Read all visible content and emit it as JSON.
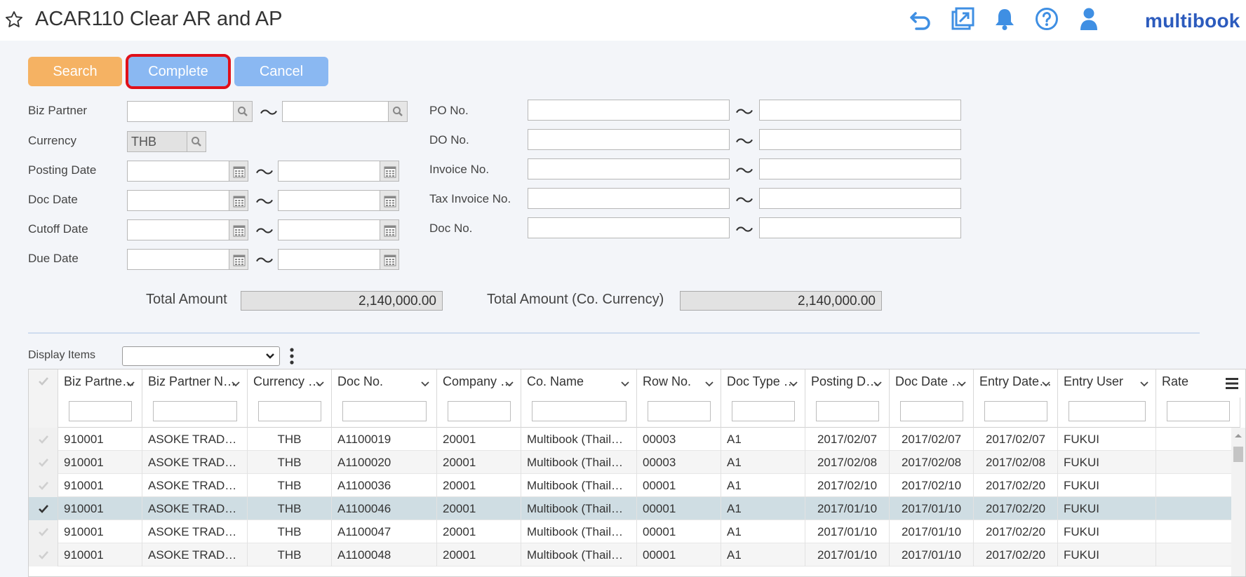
{
  "header": {
    "title": "ACAR110 Clear AR and AP",
    "brand": "multibook",
    "icons": [
      "star-icon",
      "undo-icon",
      "external-window-icon",
      "bell-icon",
      "help-icon",
      "user-icon"
    ],
    "accent": "#3f8fe3"
  },
  "toolbar": {
    "search_label": "Search",
    "complete_label": "Complete",
    "cancel_label": "Cancel"
  },
  "form": {
    "biz_partner_label": "Biz Partner",
    "currency_label": "Currency",
    "currency_value": "THB",
    "posting_date_label": "Posting Date",
    "doc_date_label": "Doc Date",
    "cutoff_date_label": "Cutoff Date",
    "due_date_label": "Due Date",
    "po_no_label": "PO No.",
    "do_no_label": "DO No.",
    "invoice_no_label": "Invoice No.",
    "tax_invoice_no_label": "Tax Invoice No.",
    "doc_no_label": "Doc No.",
    "range_separator": "〜",
    "total_amount_label": "Total Amount",
    "total_amount_value": "2,140,000.00",
    "total_amount_co_label": "Total Amount (Co. Currency)",
    "total_amount_co_value": "2,140,000.00"
  },
  "grid": {
    "display_items_label": "Display Items",
    "columns": [
      "Biz Partne…",
      "Biz Partner N…",
      "Currency …",
      "Doc No.",
      "Company …",
      "Co. Name",
      "Row No.",
      "Doc Type …",
      "Posting D…",
      "Doc Date …",
      "Entry Date…",
      "Entry User",
      "Rate"
    ],
    "rows": [
      {
        "checked": false,
        "cells": [
          "910001",
          "ASOKE TRAD…",
          "THB",
          "A1100019",
          "20001",
          "Multibook (Thail…",
          "00003",
          "A1",
          "2017/02/07",
          "2017/02/07",
          "2017/02/07",
          "FUKUI",
          ""
        ]
      },
      {
        "checked": false,
        "cells": [
          "910001",
          "ASOKE TRAD…",
          "THB",
          "A1100020",
          "20001",
          "Multibook (Thail…",
          "00003",
          "A1",
          "2017/02/08",
          "2017/02/08",
          "2017/02/08",
          "FUKUI",
          ""
        ]
      },
      {
        "checked": false,
        "cells": [
          "910001",
          "ASOKE TRAD…",
          "THB",
          "A1100036",
          "20001",
          "Multibook (Thail…",
          "00001",
          "A1",
          "2017/02/10",
          "2017/02/10",
          "2017/02/20",
          "FUKUI",
          ""
        ]
      },
      {
        "checked": true,
        "cells": [
          "910001",
          "ASOKE TRAD…",
          "THB",
          "A1100046",
          "20001",
          "Multibook (Thail…",
          "00001",
          "A1",
          "2017/01/10",
          "2017/01/10",
          "2017/02/20",
          "FUKUI",
          ""
        ]
      },
      {
        "checked": false,
        "cells": [
          "910001",
          "ASOKE TRAD…",
          "THB",
          "A1100047",
          "20001",
          "Multibook (Thail…",
          "00001",
          "A1",
          "2017/01/10",
          "2017/01/10",
          "2017/02/20",
          "FUKUI",
          ""
        ]
      },
      {
        "checked": false,
        "cells": [
          "910001",
          "ASOKE TRAD…",
          "THB",
          "A1100048",
          "20001",
          "Multibook (Thail…",
          "00001",
          "A1",
          "2017/01/10",
          "2017/01/10",
          "2017/02/20",
          "FUKUI",
          ""
        ]
      }
    ],
    "selected_row_color": "#cfdde3"
  }
}
